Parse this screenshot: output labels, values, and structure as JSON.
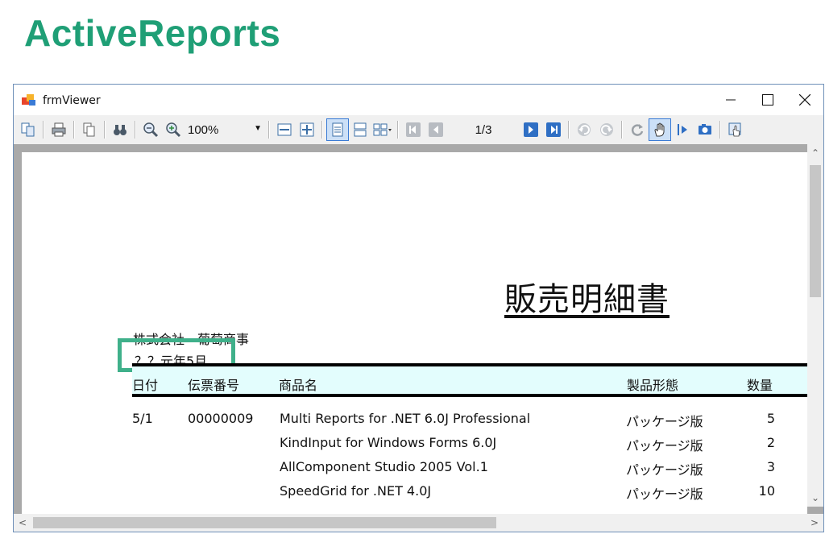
{
  "heading": "ActiveReports",
  "window": {
    "title": "frmViewer",
    "buttons": {
      "minimize": "—",
      "maximize": "☐",
      "close": "✕"
    }
  },
  "toolbar": {
    "zoom_value": "100%",
    "page_indicator": "1/3"
  },
  "report": {
    "title": "販売明細書",
    "company": "株式会社　葡萄商事",
    "period": "？？元年5月",
    "columns": {
      "date": "日付",
      "slip": "伝票番号",
      "product": "商品名",
      "form": "製品形態",
      "qty": "数量"
    },
    "rows": [
      {
        "date": "5/1",
        "slip": "00000009",
        "product": "Multi Reports for .NET 6.0J Professional",
        "form": "パッケージ版",
        "qty": "5"
      },
      {
        "date": "",
        "slip": "",
        "product": "KindInput for Windows Forms 6.0J",
        "form": "パッケージ版",
        "qty": "2"
      },
      {
        "date": "",
        "slip": "",
        "product": "AllComponent Studio 2005 Vol.1",
        "form": "パッケージ版",
        "qty": "3"
      },
      {
        "date": "",
        "slip": "",
        "product": "SpeedGrid for .NET 4.0J",
        "form": "パッケージ版",
        "qty": "10"
      }
    ]
  },
  "colors": {
    "heading": "#1f9f76",
    "highlight_box": "#3fb08a",
    "header_band": "#e3fdfd"
  }
}
